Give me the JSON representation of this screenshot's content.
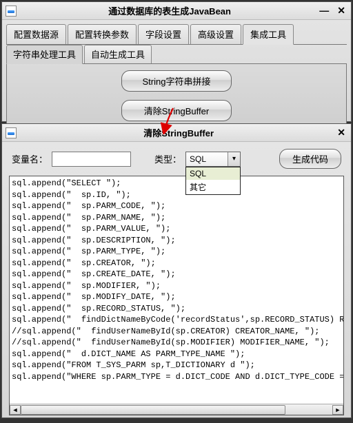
{
  "top": {
    "title": "通过数据库的表生成JavaBean",
    "tabs": [
      "配置数据源",
      "配置转换参数",
      "字段设置",
      "高级设置",
      "集成工具"
    ],
    "active_tab": 4,
    "subtabs": [
      "字符串处理工具",
      "自动生成工具"
    ],
    "active_subtab": 0,
    "btn_string_concat": "String字符串拼接",
    "btn_clear_sb": "清除StringBuffer"
  },
  "bottom": {
    "title": "清除StringBuffer",
    "var_label": "变量名：",
    "var_value": "",
    "type_label": "类型：",
    "type_selected": "SQL",
    "type_options": [
      "SQL",
      "其它"
    ],
    "gen_btn": "生成代码",
    "code_lines": [
      "sql.append(\"SELECT \");",
      "sql.append(\"  sp.ID, \");",
      "sql.append(\"  sp.PARM_CODE, \");",
      "sql.append(\"  sp.PARM_NAME, \");",
      "sql.append(\"  sp.PARM_VALUE, \");",
      "sql.append(\"  sp.DESCRIPTION, \");",
      "sql.append(\"  sp.PARM_TYPE, \");",
      "sql.append(\"  sp.CREATOR, \");",
      "sql.append(\"  sp.CREATE_DATE, \");",
      "sql.append(\"  sp.MODIFIER, \");",
      "sql.append(\"  sp.MODIFY_DATE, \");",
      "sql.append(\"  sp.RECORD_STATUS, \");",
      "sql.append(\"  findDictNameByCode('recordStatus',sp.RECORD_STATUS) RECORD_STATUS_",
      "//sql.append(\"  findUserNameById(sp.CREATOR) CREATOR_NAME, \");",
      "//sql.append(\"  findUserNameById(sp.MODIFIER) MODIFIER_NAME, \");",
      "sql.append(\"  d.DICT_NAME AS PARM_TYPE_NAME \");",
      "sql.append(\"FROM T_SYS_PARM sp,T_DICTIONARY d \");",
      "sql.append(\"WHERE sp.PARM_TYPE = d.DICT_CODE AND d.DICT_TYPE_CODE = 'parameterTy"
    ]
  }
}
